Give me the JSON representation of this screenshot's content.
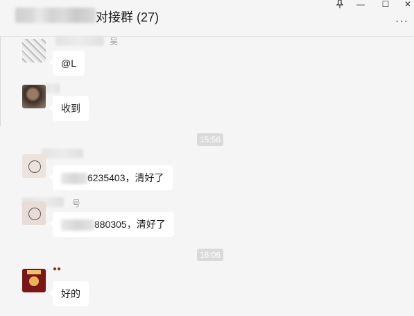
{
  "window": {
    "title": "对接群 (27)",
    "controls": {
      "pin_icon": "pin-icon",
      "minimize": "—",
      "maximize": "☐",
      "close": "✕",
      "more": "···"
    }
  },
  "messages": [
    {
      "sender_visible": "吴",
      "avatar": "manga-girl-avatar",
      "text": "@L"
    },
    {
      "sender_visible": "",
      "avatar": "photo-avatar",
      "text": "收到"
    },
    {
      "timestamp": "15:56"
    },
    {
      "sender_visible": "",
      "avatar": "cartoon-avatar",
      "text_suffix": "6235403，清好了"
    },
    {
      "sender_visible": "号",
      "avatar": "cartoon-avatar",
      "text_suffix": "880305，清好了"
    },
    {
      "timestamp": "16:06"
    },
    {
      "sender_visible": "",
      "avatar": "red-cartoon-avatar",
      "text": "好的"
    }
  ]
}
